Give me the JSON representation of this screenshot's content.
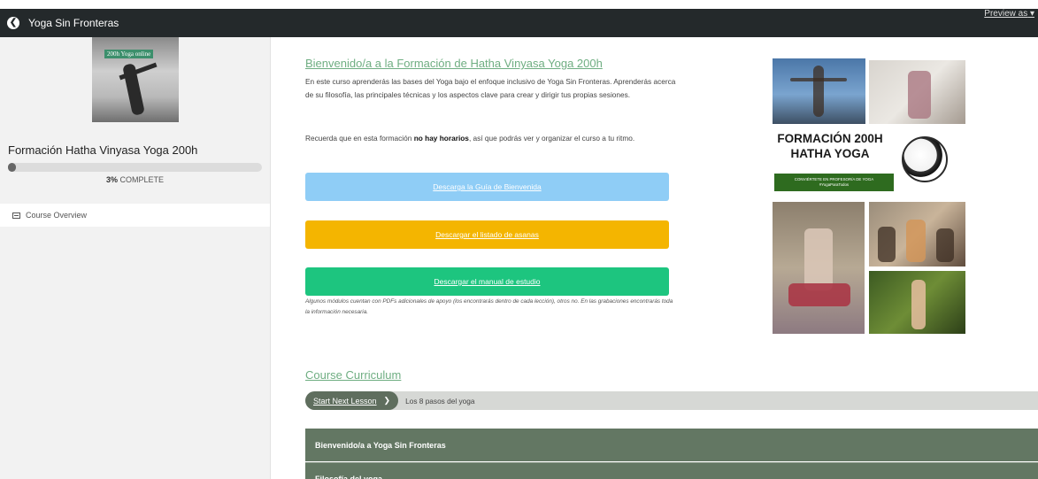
{
  "topbar": {
    "back_icon": "arrow-left-circle-icon",
    "brand": "Yoga Sin Fronteras",
    "preview": "Preview as"
  },
  "sidebar": {
    "cover_tag": "200h Yoga online",
    "course_title": "Formación Hatha Vinyasa Yoga 200h",
    "progress_fraction": 0.03,
    "progress_pct": "3%",
    "progress_label": "COMPLETE",
    "overview_icon": "list-icon",
    "overview_label": "Course Overview"
  },
  "main": {
    "title": "Bienvenido/a a la Formación de Hatha Vinyasa Yoga 200h",
    "intro": "En este curso aprenderás las bases del Yoga bajo el enfoque inclusivo de Yoga Sin Fronteras. Aprenderás acerca de su filosofía, las principales técnicas y los aspectos clave para crear y dirigir tus propias sesiones.",
    "reminder_pre": "Recuerda que en esta formación ",
    "reminder_bold": "no hay horarios",
    "reminder_post": ", así que podrás ver y organizar el curso a tu ritmo.",
    "buttons": [
      {
        "label": "Descarga la Guía de Bienvenida",
        "color": "#8fcdf6"
      },
      {
        "label": "Descargar el listado de asanas",
        "color": "#f4b500"
      },
      {
        "label": "Descargar el manual de estudio",
        "color": "#1dc57f"
      }
    ],
    "note": "Algunos módulos cuentan con PDFs adicionales de apoyo (los encontrarás dentro de cada lección), otros no. En las grabaciones encontrarás toda la información necesaria.",
    "collage": {
      "title": "FORMACIÓN 200H HATHA YOGA",
      "badge_line1": "CONVIÉRTETE EN PROFESOR/A DE YOGA",
      "badge_line2": "#YogaParaTodos"
    }
  },
  "curriculum": {
    "title": "Course Curriculum",
    "next_button": "Start Next Lesson",
    "next_lesson": "Los 8 pasos del yoga",
    "sections": [
      "Bienvenido/a a Yoga Sin Fronteras",
      "Filosofía del yoga"
    ]
  },
  "colors": {
    "accent": "#6fae82",
    "section_bg": "#637763"
  }
}
